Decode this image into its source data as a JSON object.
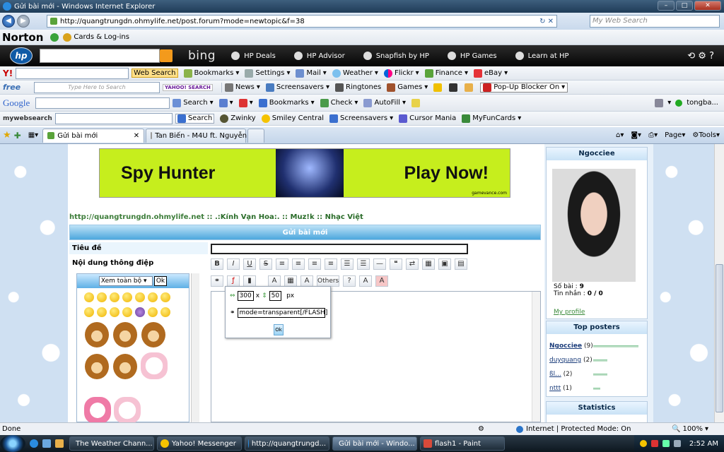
{
  "window": {
    "title": "Gửi bài mới - Windows Internet Explorer"
  },
  "address": {
    "url": "http://quangtrungdn.ohmylife.net/post.forum?mode=newtopic&f=38",
    "search_placeholder": "My Web Search"
  },
  "norton": {
    "logo": "Norton",
    "cards": "Cards & Log-ins"
  },
  "hp": {
    "bing": "bing",
    "items": [
      "HP Deals",
      "HP Advisor",
      "Snapfish by HP",
      "HP Games",
      "Learn at HP"
    ]
  },
  "yahoo": {
    "logo": "Y!",
    "web_search": "Web Search",
    "items": [
      "Bookmarks",
      "Settings",
      "Mail",
      "Weather",
      "Flickr",
      "Finance",
      "eBay"
    ]
  },
  "freecause": {
    "logo": "free",
    "search_placeholder": "Type Here to Search",
    "yahoo_label": "YAHOO! SEARCH",
    "items": [
      "News",
      "Screensavers",
      "Ringtones",
      "Games"
    ],
    "popup": "Pop-Up Blocker On"
  },
  "google": {
    "logo": "Google",
    "items": [
      "Search",
      "Bookmarks",
      "Check",
      "AutoFill"
    ],
    "account": "tongba..."
  },
  "myweb": {
    "logo": "mywebsearch",
    "items": [
      "Search",
      "Zwinky",
      "Smiley Central",
      "Screensavers",
      "Cursor Mania",
      "MyFunCards"
    ]
  },
  "tabs": [
    {
      "label": "Gửi bài mới"
    },
    {
      "label": "Tan Biến - M4U ft. Nguyễn..."
    }
  ],
  "ie_cmd": {
    "page": "Page",
    "tools": "Tools"
  },
  "banner": {
    "left": "Spy Hunter",
    "right": "Play Now!",
    "small": "gamevance.com"
  },
  "forum": {
    "site": "http://quangtrungdn.ohmylife.net",
    "crumb": ":: .:Kính Vạn Hoa:. :: Muz!k :: Nhạc Việt",
    "form_title": "Gửi bài mới",
    "label_title": "Tiêu đề",
    "label_message": "Nội dung thông điệp",
    "others": "Others",
    "smiley_select": "Xem toàn bộ",
    "smiley_ok": "Ok",
    "flash": {
      "width": "300",
      "x": "x",
      "height": "50",
      "unit": "px",
      "param": "mode=transparent[/FLASH]",
      "ok": "Ok"
    }
  },
  "profile": {
    "name": "Ngocciee",
    "posts_label": "Số bài :",
    "posts": "9",
    "msgs_label": "Tin nhắn :",
    "msgs": "0 / 0",
    "link": "My profile"
  },
  "top_posters": {
    "title": "Top posters",
    "rows": [
      {
        "name": "Ngocciee",
        "count": "(9)"
      },
      {
        "name": "duyquang",
        "count": "(2)"
      },
      {
        "name": "ßl...",
        "count": "(2)"
      },
      {
        "name": "nttt",
        "count": "(1)"
      }
    ]
  },
  "statistics": {
    "title": "Statistics"
  },
  "status": {
    "left": "Done",
    "zone": "Internet | Protected Mode: On",
    "zoom": "100%"
  },
  "taskbar": {
    "tasks": [
      "The Weather Chann...",
      "Yahoo! Messenger",
      "http://quangtrungd...",
      "Gửi bài mới - Windo...",
      "flash1 - Paint"
    ],
    "clock": "2:52 AM"
  }
}
